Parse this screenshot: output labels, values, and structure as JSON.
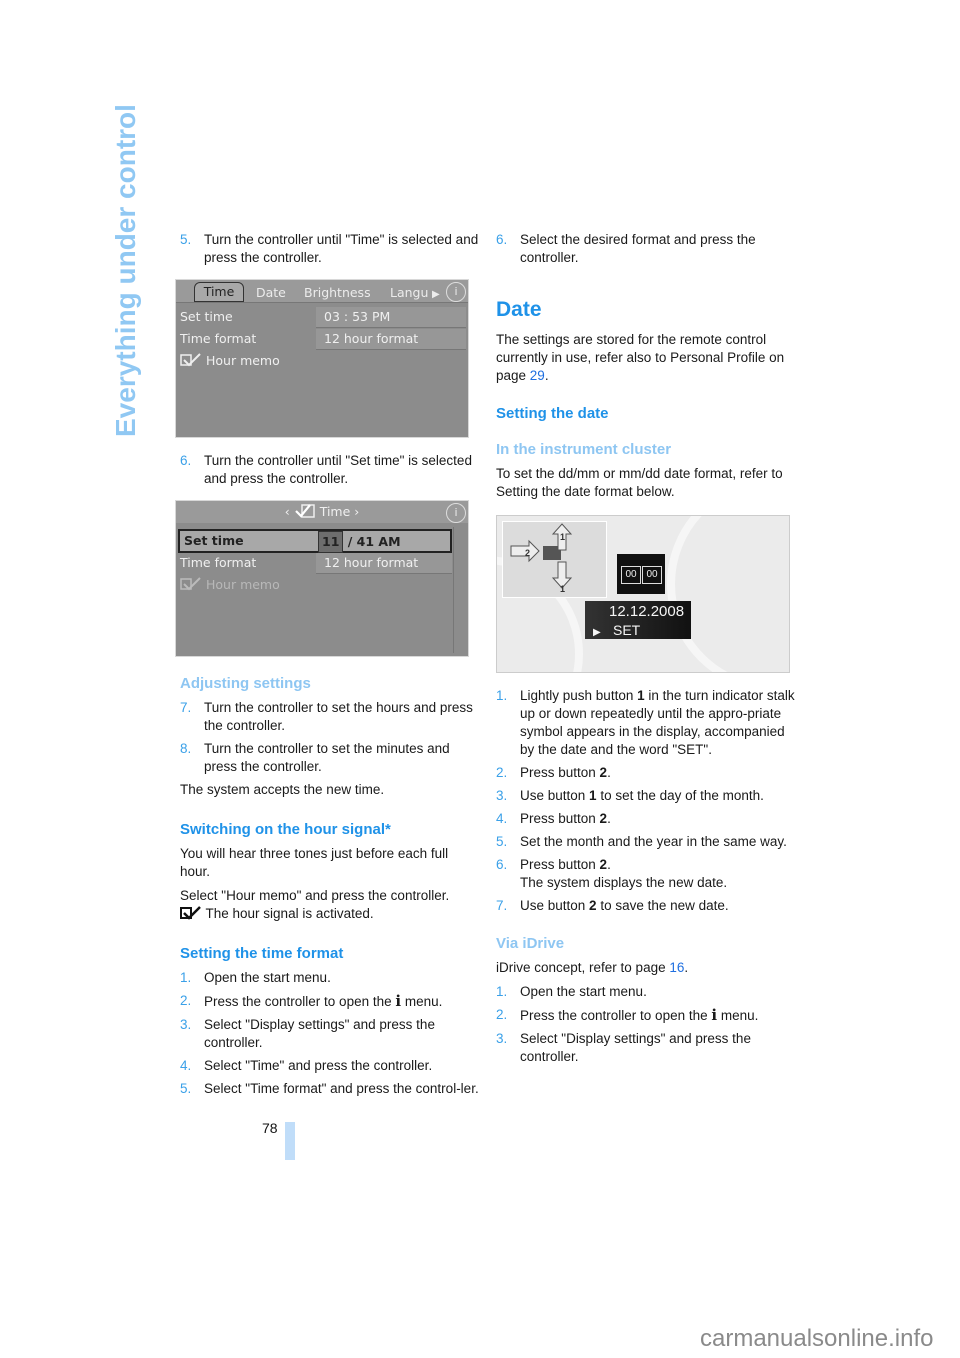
{
  "side_title": "Everything under control",
  "page_number": "78",
  "watermark": "carmanualsonline.info",
  "left": {
    "step5": {
      "num": "5.",
      "text": "Turn the controller until \"Time\" is selected and press the controller."
    },
    "screen1": {
      "tabs": [
        "Time",
        "Date",
        "Brightness",
        "Langu"
      ],
      "tab_more": "▶",
      "info": "i",
      "rows": [
        "Set time",
        "Time format",
        "Hour memo"
      ],
      "values": [
        "03 : 53 PM",
        "12 hour format"
      ]
    },
    "step6": {
      "num": "6.",
      "text": "Turn the controller until \"Set time\" is selected and press the controller."
    },
    "screen2": {
      "header": "Time",
      "nav_left": "‹",
      "nav_right": "›",
      "info": "i",
      "rows": [
        "Set time",
        "Time format",
        "Hour memo"
      ],
      "hour_value": "11",
      "minute_value": "/ 41 AM",
      "format_value": "12 hour format"
    },
    "adjusting": {
      "heading": "Adjusting settings",
      "steps": [
        {
          "num": "7.",
          "text": "Turn the controller to set the hours and press the controller."
        },
        {
          "num": "8.",
          "text": "Turn the controller to set the minutes and press the controller."
        }
      ],
      "after": "The system accepts the new time."
    },
    "hour_signal": {
      "heading": "Switching on the hour signal*",
      "p1": "You will hear three tones just before each full hour.",
      "p2": "Select \"Hour memo\" and press the controller.",
      "p3": "The hour signal is activated."
    },
    "time_format": {
      "heading": "Setting the time format",
      "steps": [
        {
          "num": "1.",
          "text": "Open the start menu."
        },
        {
          "num": "2.",
          "pre": "Press the controller to open the ",
          "icon": "i",
          "post": " menu."
        },
        {
          "num": "3.",
          "text": "Select \"Display settings\" and press the controller."
        },
        {
          "num": "4.",
          "text": "Select \"Time\" and press the controller."
        },
        {
          "num": "5.",
          "text": "Select \"Time format\" and press the control-ler."
        }
      ]
    }
  },
  "right": {
    "step6": {
      "num": "6.",
      "text": "Select the desired format and press the controller."
    },
    "date": {
      "heading": "Date",
      "p_pre": "The settings are stored for the remote control currently in use, refer also to Personal Profile on page ",
      "p_link": "29",
      "p_post": "."
    },
    "setting_date": {
      "heading": "Setting the date"
    },
    "cluster": {
      "heading": "In the instrument cluster",
      "p": "To set the dd/mm or mm/dd date format, refer to Setting the date format below.",
      "display": {
        "date": "12.12.2008",
        "set": "SET",
        "digits": [
          "00",
          "00"
        ],
        "button_labels": [
          "1",
          "2",
          "1"
        ]
      },
      "steps": [
        {
          "num": "1.",
          "pre": "Lightly push button ",
          "bold": "1",
          "post": " in the turn indicator stalk up or down repeatedly until the appro-priate symbol appears in the display, accompanied by the date and the word \"SET\"."
        },
        {
          "num": "2.",
          "pre": "Press button ",
          "bold": "2",
          "post": "."
        },
        {
          "num": "3.",
          "pre": "Use button ",
          "bold": "1",
          "post": " to set the day of the month."
        },
        {
          "num": "4.",
          "pre": "Press button ",
          "bold": "2",
          "post": "."
        },
        {
          "num": "5.",
          "pre": "Set the month and the year in the same way.",
          "bold": "",
          "post": ""
        },
        {
          "num": "6.",
          "pre": "Press button ",
          "bold": "2",
          "post": ".",
          "extra": "The system displays the new date."
        },
        {
          "num": "7.",
          "pre": "Use button ",
          "bold": "2",
          "post": " to save the new date."
        }
      ]
    },
    "idrive": {
      "heading": "Via iDrive",
      "p_pre": "iDrive concept, refer to page ",
      "p_link": "16",
      "p_post": ".",
      "steps": [
        {
          "num": "1.",
          "text": "Open the start menu."
        },
        {
          "num": "2.",
          "pre": "Press the controller to open the ",
          "icon": "i",
          "post": " menu."
        },
        {
          "num": "3.",
          "text": "Select \"Display settings\" and press the controller."
        }
      ]
    }
  }
}
